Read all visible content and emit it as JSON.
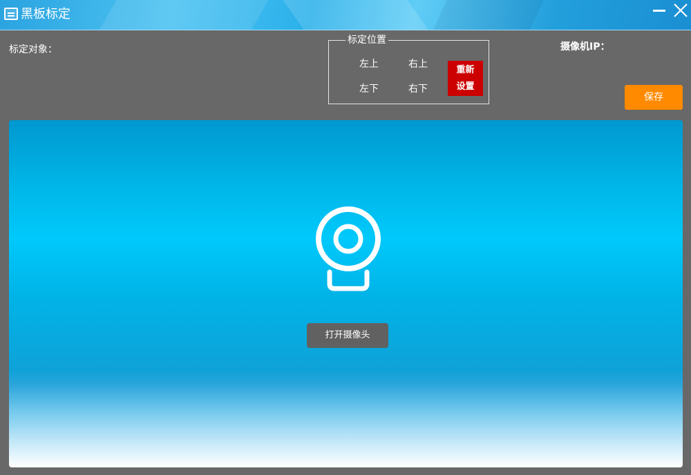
{
  "window": {
    "title": "黑板标定",
    "titlebar_color": "#2aa3e0"
  },
  "icons": {
    "app": "blackboard-icon",
    "minimize": "minimize-icon",
    "close": "close-icon",
    "camera": "webcam-icon"
  },
  "top": {
    "target_label": "标定对象：",
    "camera_ip_label": "摄像机IP："
  },
  "position_group": {
    "legend": "标定位置",
    "top_left": "左上",
    "top_right": "右上",
    "bottom_left": "左下",
    "bottom_right": "右下",
    "reset_line1": "重新",
    "reset_line2": "设置",
    "reset_color": "#cc0000"
  },
  "save": {
    "label": "保存",
    "color": "#ff8a00"
  },
  "camera_panel": {
    "open_button_label": "打开摄像头",
    "bg_color": "#00c9fb"
  }
}
